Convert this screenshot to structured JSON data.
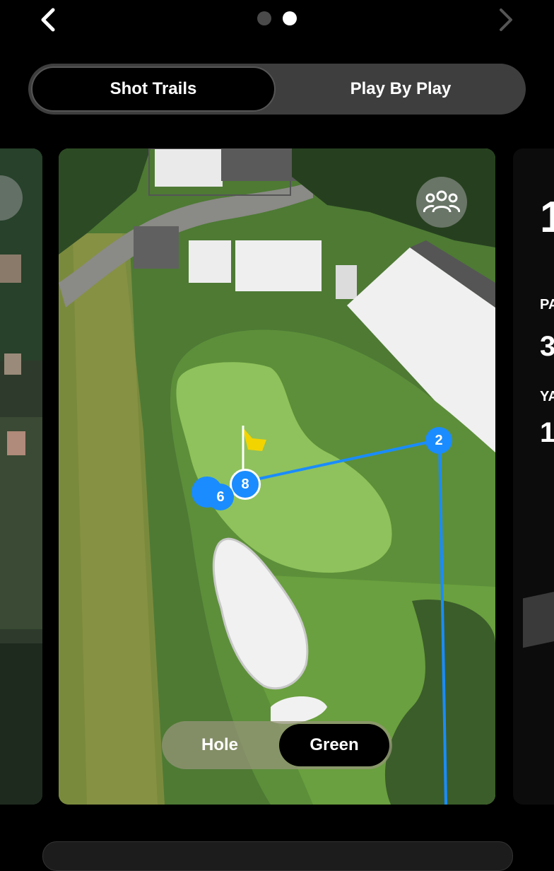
{
  "nav": {
    "back_icon": "chevron-left-icon",
    "forward_icon": "chevron-right-icon",
    "page_count": 2,
    "active_page": 2
  },
  "tabs": [
    {
      "label": "Shot Trails",
      "active": true
    },
    {
      "label": "Play By Play",
      "active": false
    }
  ],
  "map": {
    "group_icon": "people-group-icon",
    "flag_icon": "flag-icon",
    "shots": [
      {
        "label": "2"
      },
      {
        "label": "8"
      },
      {
        "label": "6"
      }
    ],
    "view_toggle": {
      "hole": "Hole",
      "green": "Green",
      "selected": "Green"
    }
  },
  "right_card": {
    "hole_partial": "1",
    "par_label_partial": "PA",
    "par_partial": "3",
    "yards_label_partial": "YA",
    "yards_partial": "1"
  },
  "colors": {
    "accent": "#1a8cff",
    "flag": "#f2d400",
    "dot_active": "#ffffff",
    "dot_inactive": "#4a4a4a"
  }
}
